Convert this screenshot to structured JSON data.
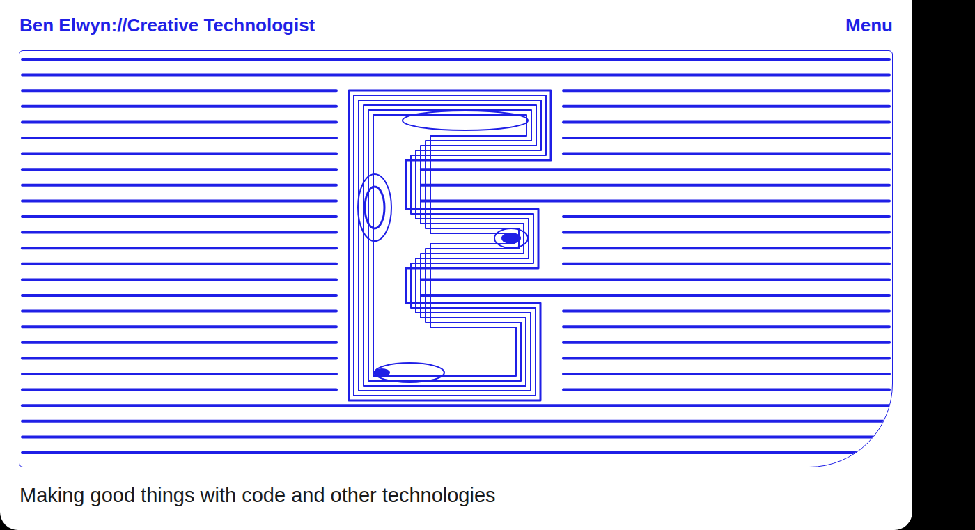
{
  "header": {
    "title": "Ben Elwyn://Creative Technologist",
    "menu": "Menu"
  },
  "tagline": "Making good things with code and other technologies"
}
